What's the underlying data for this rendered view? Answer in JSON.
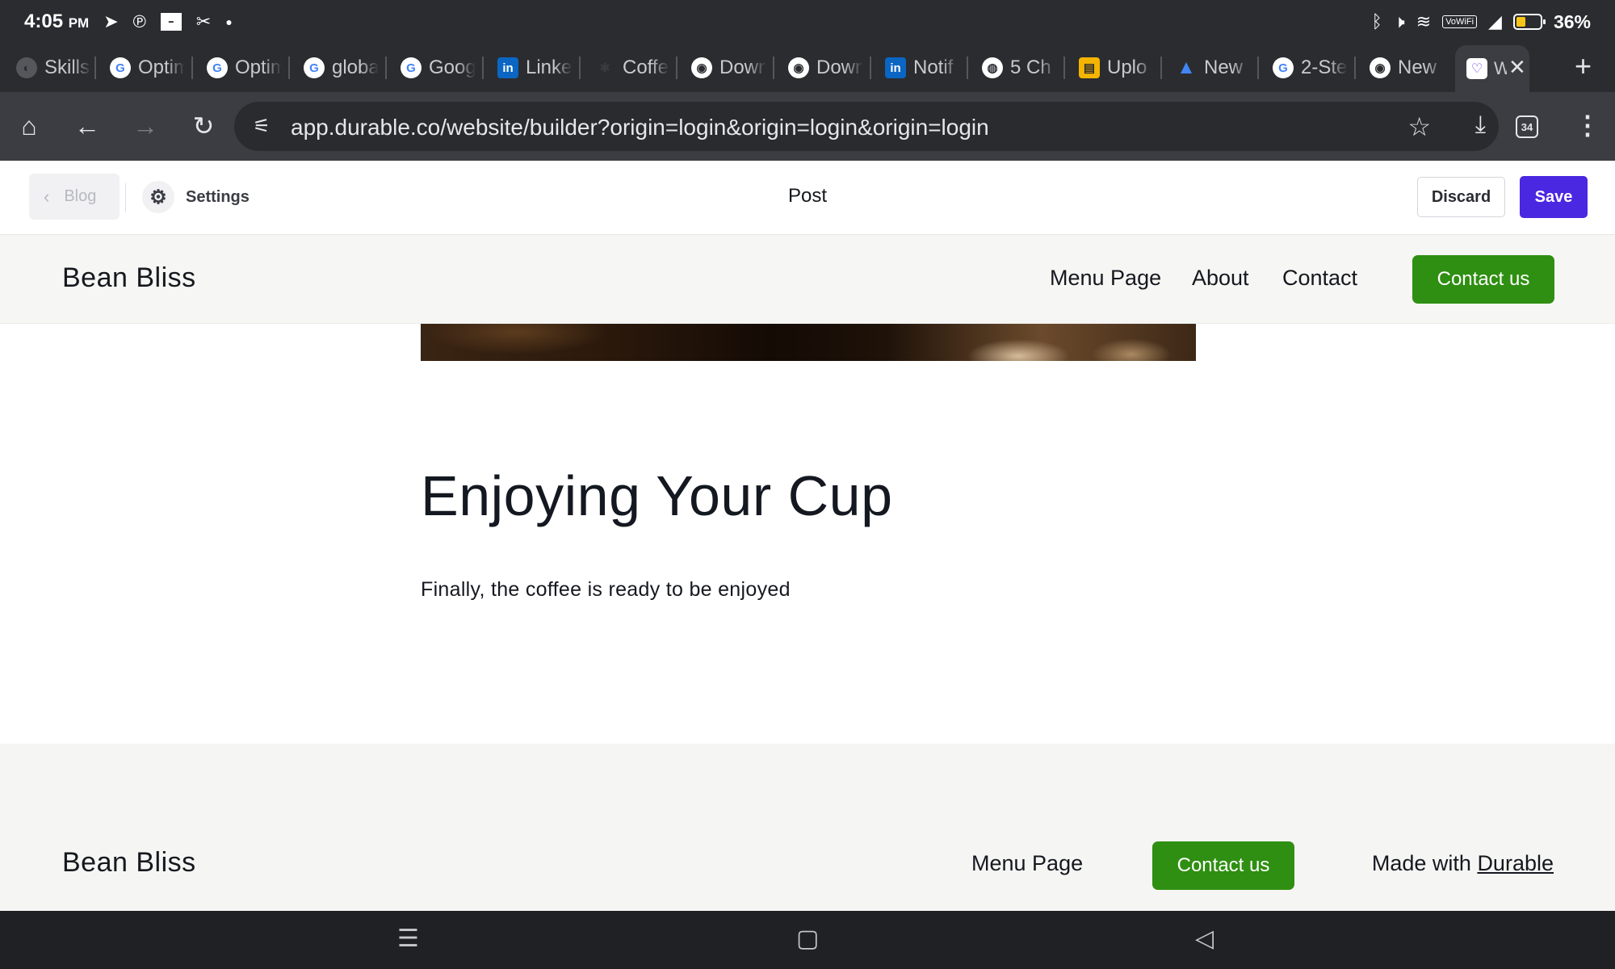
{
  "status_bar": {
    "time": "4:05",
    "ampm": "PM",
    "battery_percent": "36%",
    "battery_level": 0.36,
    "wifi_label": "VoWiFi",
    "left_icons": [
      "telegram-icon",
      "pinterest-icon",
      "app-news-icon",
      "scissors-icon",
      "dot-icon"
    ],
    "right_icons": [
      "bluetooth-icon",
      "mute-icon",
      "wifi-icon",
      "signal-icon",
      "battery-icon"
    ]
  },
  "tabs": [
    {
      "label": "Skills",
      "favicon": "globe-dark-icon"
    },
    {
      "label": "Optim",
      "favicon": "google-icon"
    },
    {
      "label": "Optim",
      "favicon": "google-icon"
    },
    {
      "label": "globa",
      "favicon": "google-icon"
    },
    {
      "label": "Goog",
      "favicon": "google-icon"
    },
    {
      "label": "Linke",
      "favicon": "linkedin-icon"
    },
    {
      "label": "Coffe",
      "favicon": "leaf-icon"
    },
    {
      "label": "Down",
      "favicon": "chrome-icon"
    },
    {
      "label": "Down",
      "favicon": "chrome-icon"
    },
    {
      "label": "Notif",
      "favicon": "linkedin-icon"
    },
    {
      "label": "5 Ch",
      "favicon": "globe-icon"
    },
    {
      "label": "Uplo",
      "favicon": "upload-icon"
    },
    {
      "label": "New",
      "favicon": "google-ads-icon"
    },
    {
      "label": "2-Ste",
      "favicon": "google-icon"
    },
    {
      "label": "New",
      "favicon": "chrome-icon"
    }
  ],
  "active_tab": {
    "label": "W",
    "favicon": "durable-icon"
  },
  "browser": {
    "url": "app.durable.co/website/builder?origin=login&origin=login&origin=login",
    "tab_count": "34"
  },
  "builder": {
    "back_label": "Blog",
    "settings_label": "Settings",
    "page_title": "Post",
    "discard_label": "Discard",
    "save_label": "Save"
  },
  "site": {
    "brand": "Bean Bliss",
    "nav": [
      "Menu Page",
      "About",
      "Contact"
    ],
    "cta_label": "Contact us"
  },
  "post": {
    "heading": "Enjoying Your Cup",
    "body": "Finally, the coffee is ready to be enjoyed"
  },
  "footer": {
    "brand": "Bean Bliss",
    "link": "Menu Page",
    "cta_label": "Contact us",
    "made_with_prefix": "Made with",
    "made_with_link": "Durable"
  },
  "colors": {
    "brand_green": "#2f8f12",
    "save_purple": "#4a27e0",
    "chrome_dark": "#2b2c30"
  }
}
